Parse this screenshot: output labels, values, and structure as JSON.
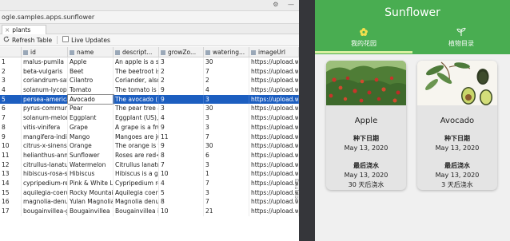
{
  "inspector": {
    "top_icons": [
      "⚙",
      "—"
    ],
    "database_name": "ogle.samples.apps.sunflower",
    "table_tab": {
      "close": "×",
      "label": "plants"
    },
    "toolbar": {
      "refresh_label": "Refresh Table",
      "live_updates_label": "Live Updates"
    },
    "columns": [
      "",
      "id",
      "name",
      "descript...",
      "growZo...",
      "watering...",
      "imageUrl"
    ],
    "rows": [
      [
        "1",
        "malus-pumila",
        "Apple",
        "An apple is a swe",
        "3",
        "30",
        "https://upload.wi"
      ],
      [
        "2",
        "beta-vulgaris",
        "Beet",
        "The beetroot is t",
        "2",
        "7",
        "https://upload.wi"
      ],
      [
        "3",
        "coriandrum-sativ",
        "Cilantro",
        "Coriander, also k",
        "2",
        "2",
        "https://upload.wi"
      ],
      [
        "4",
        "solanum-lycopers",
        "Tomato",
        "The tomato is the",
        "9",
        "4",
        "https://upload.wi"
      ],
      [
        "5",
        "persea-americana",
        "Avocado",
        "The avocado (Pe",
        "9",
        "3",
        "https://upload.wi"
      ],
      [
        "6",
        "pyrus-communis",
        "Pear",
        "The pear tree and",
        "3",
        "30",
        "https://upload.wi"
      ],
      [
        "7",
        "solanum-melonge",
        "Eggplant",
        "Eggplant (US), au",
        "4",
        "3",
        "https://upload.wi"
      ],
      [
        "8",
        "vitis-vinifera",
        "Grape",
        "A grape is a fruit,",
        "9",
        "3",
        "https://upload.wi"
      ],
      [
        "9",
        "mangifera-indica",
        "Mango",
        "Mangoes are juic",
        "11",
        "7",
        "https://upload.wi"
      ],
      [
        "10",
        "citrus-x-sinensis",
        "Orange",
        "The orange is the",
        "9",
        "30",
        "https://upload.wi"
      ],
      [
        "11",
        "helianthus-annuu",
        "Sunflower",
        "Roses are red<br",
        "8",
        "6",
        "https://upload.wi"
      ],
      [
        "12",
        "citrullus-lanatus",
        "Watermelon",
        "Citrullus lanatus i",
        "7",
        "3",
        "https://upload.wi"
      ],
      [
        "13",
        "hibiscus-rosa-sir",
        "Hibiscus",
        "Hibiscus is a gen",
        "10",
        "1",
        "https://upload.wi"
      ],
      [
        "14",
        "cypripedium-rege",
        "Pink & White Lad",
        "Cypripedium regi",
        "4",
        "7",
        "https://upload.wi"
      ],
      [
        "15",
        "aquilegia-coerule",
        "Rocky Mountain C",
        "Aquilegia coerule",
        "5",
        "3",
        "https://upload.wi"
      ],
      [
        "16",
        "magnolia-denuda",
        "Yulan Magnolia",
        "Magnolia denuda",
        "8",
        "7",
        "https://upload.wi"
      ],
      [
        "17",
        "bougainvillea-gla",
        "Bougainvillea",
        "Bougainvillea is a",
        "10",
        "21",
        "https://upload.wi"
      ]
    ],
    "selected_row_index": 4,
    "side_tab_label": "Emulator"
  },
  "app": {
    "title": "Sunflower",
    "tabs": [
      "我的花园",
      "植物目录"
    ],
    "active_tab_index": 0,
    "colors": {
      "primary": "#49ad51",
      "indicator": "#d8f0a0"
    },
    "cards": [
      {
        "name": "Apple",
        "planted_label": "种下日期",
        "planted_date": "May 13, 2020",
        "watered_label": "最后浇水",
        "watered_date": "May 13, 2020",
        "water_interval": "30 天后浇水"
      },
      {
        "name": "Avocado",
        "planted_label": "种下日期",
        "planted_date": "May 13, 2020",
        "watered_label": "最后浇水",
        "watered_date": "May 13, 2020",
        "water_interval": "3 天后浇水"
      }
    ]
  }
}
